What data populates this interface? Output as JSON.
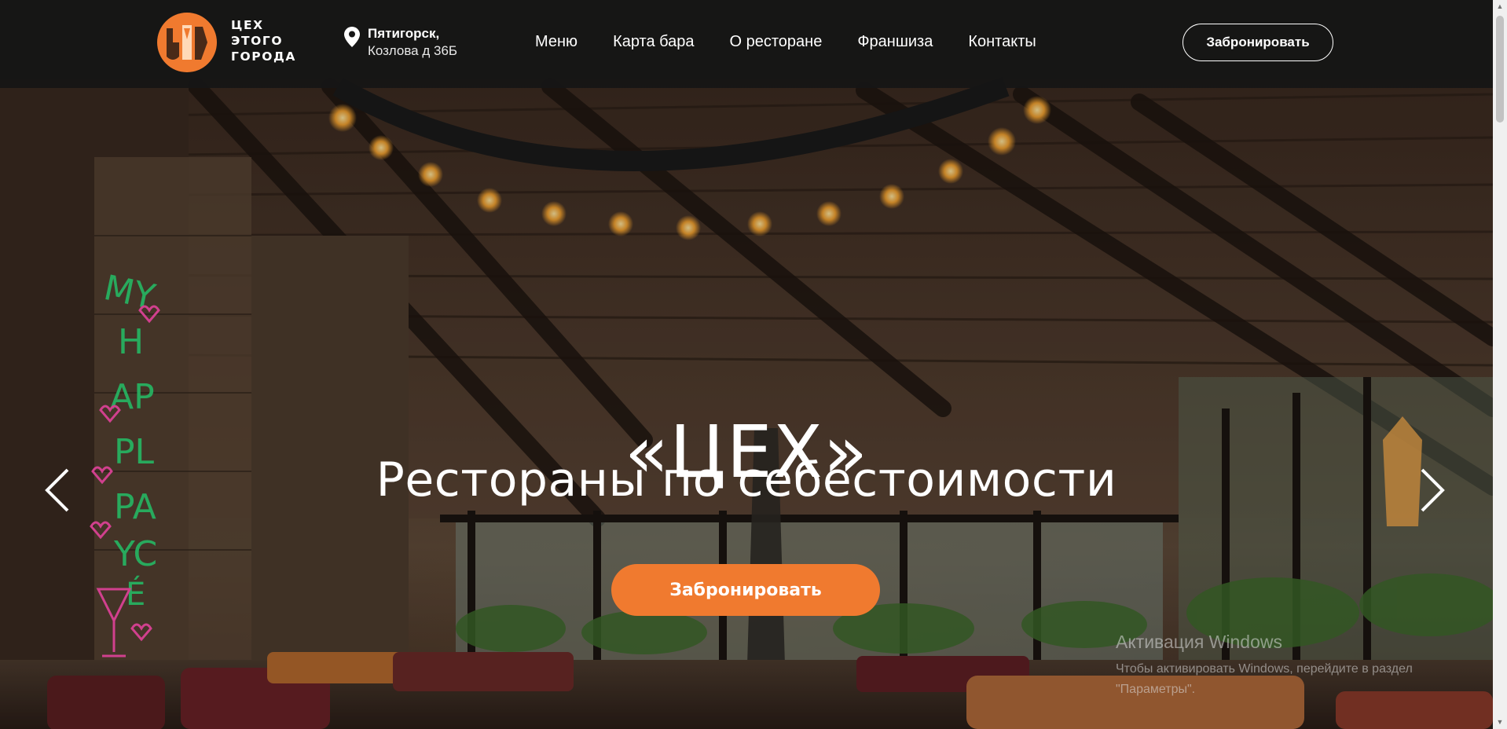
{
  "header": {
    "logo_lines": [
      "ЦЕХ",
      "ЭТОГО",
      "ГОРОДА"
    ],
    "address_city": "Пятигорск,",
    "address_street": "Козлова д 36Б",
    "nav": [
      {
        "label": "Меню"
      },
      {
        "label": "Карта бара"
      },
      {
        "label": "О ресторане"
      },
      {
        "label": "Франшиза"
      },
      {
        "label": "Контакты"
      }
    ],
    "book_label": "Забронировать"
  },
  "hero": {
    "title": "«ЦЕХ»",
    "subtitle": "Рестораны по себестоимости",
    "book_label": "Забронировать",
    "neon_sign": "MY HAPPL PLAYCE"
  },
  "windows_watermark": {
    "title": "Активация Windows",
    "line1": "Чтобы активировать Windows, перейдите в раздел",
    "line2": "\"Параметры\"."
  },
  "colors": {
    "accent": "#f07a2f",
    "header_bg": "#161616",
    "text": "#ffffff"
  }
}
